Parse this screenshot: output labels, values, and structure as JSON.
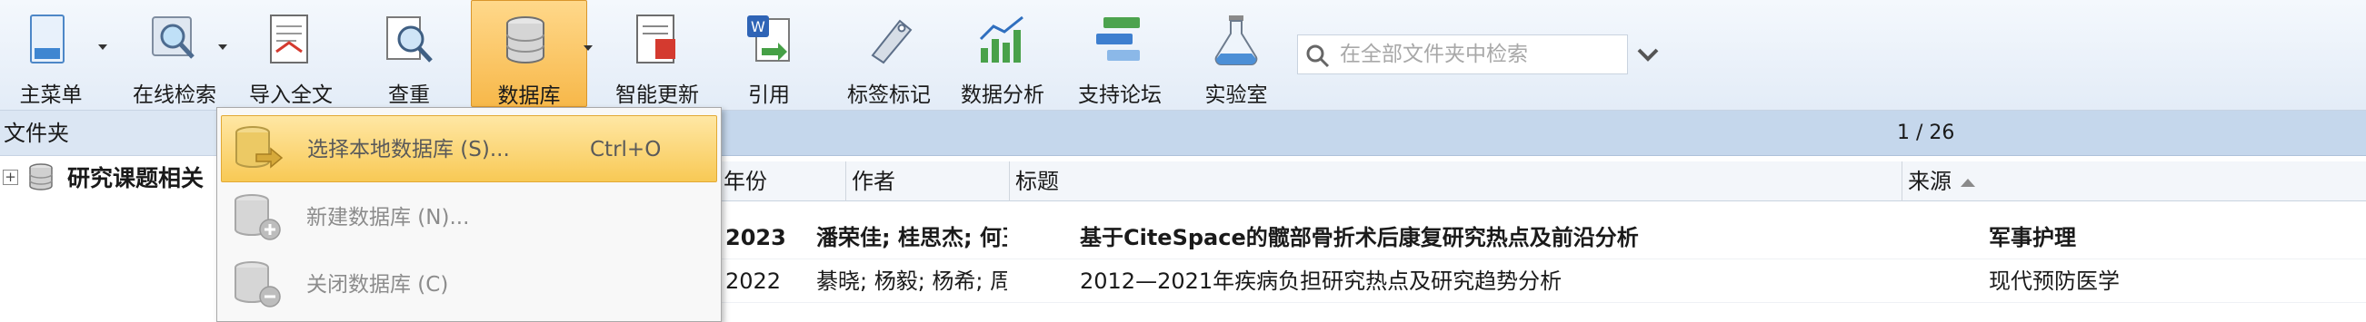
{
  "toolbar": {
    "items": [
      {
        "label": "主菜单"
      },
      {
        "label": "在线检索"
      },
      {
        "label": "导入全文"
      },
      {
        "label": "查重"
      },
      {
        "label": "数据库"
      },
      {
        "label": "智能更新"
      },
      {
        "label": "引用"
      },
      {
        "label": "标签标记"
      },
      {
        "label": "数据分析"
      },
      {
        "label": "支持论坛"
      },
      {
        "label": "实验室"
      }
    ],
    "active_item": "数据库",
    "search_placeholder": "在全部文件夹中检索"
  },
  "folder_pane": {
    "header": "文件夹",
    "node_label": "研究课题相关"
  },
  "grid": {
    "pager": "1 / 26",
    "columns": {
      "year": "年份",
      "author": "作者",
      "title": "标题",
      "source": "来源"
    },
    "sort_column": "来源",
    "rows": [
      {
        "year": "2023",
        "author": "潘荣佳; 桂思杰; 何玉...",
        "title": "基于CiteSpace的髋部骨折术后康复研究热点及前沿分析",
        "source": "军事护理",
        "bold": true
      },
      {
        "year": "2022",
        "author": "綦晓; 杨毅; 杨希; 周立...",
        "title": "2012—2021年疾病负担研究热点及研究趋势分析",
        "source": "现代预防医学",
        "bold": false
      }
    ]
  },
  "db_menu": {
    "items": [
      {
        "label": "选择本地数据库 (S)...",
        "shortcut": "Ctrl+O",
        "highlighted": true
      },
      {
        "label": "新建数据库 (N)...",
        "shortcut": "",
        "highlighted": false
      },
      {
        "label": "关闭数据库 (C)",
        "shortcut": "",
        "highlighted": false
      }
    ]
  },
  "colors": {
    "ribbon": "#e3ecf7",
    "active_tool": "#f7b84a",
    "pager_bar": "#c5d7ec",
    "menu_highlight": "#f8c955"
  }
}
